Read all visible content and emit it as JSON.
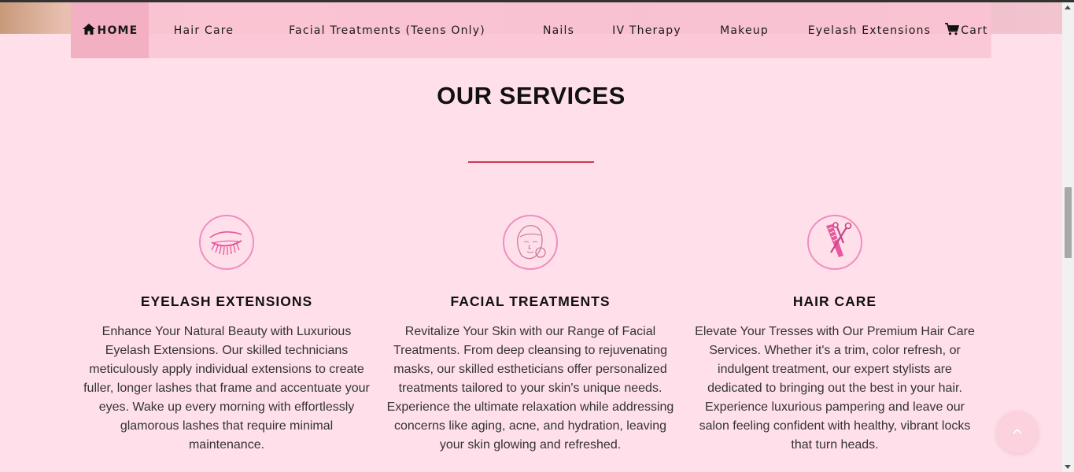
{
  "nav": {
    "items": [
      {
        "label": "HOME",
        "icon": "home-icon",
        "active": true
      },
      {
        "label": "Hair Care"
      },
      {
        "label": "Facial Treatments (Teens Only)"
      },
      {
        "label": "Nails"
      },
      {
        "label": "IV Therapy"
      },
      {
        "label": "Makeup"
      },
      {
        "label": "Eyelash Extensions"
      },
      {
        "label": "Cart",
        "icon": "cart-icon"
      }
    ]
  },
  "section": {
    "title": "OUR SERVICES"
  },
  "services": [
    {
      "icon": "eyelash-icon",
      "title": "EYELASH EXTENSIONS",
      "description": "Enhance Your Natural Beauty with Luxurious Eyelash Extensions. Our skilled technicians meticulously apply individual extensions to create fuller, longer lashes that frame and accentuate your eyes. Wake up every morning with effortlessly glamorous lashes that require minimal maintenance."
    },
    {
      "icon": "face-icon",
      "title": "FACIAL TREATMENTS",
      "description": "Revitalize Your Skin with our Range of Facial Treatments. From deep cleansing to rejuvenating masks, our skilled estheticians offer personalized treatments tailored to your skin's unique needs. Experience the ultimate relaxation while addressing concerns like aging, acne, and hydration, leaving your skin glowing and refreshed."
    },
    {
      "icon": "scissors-comb-icon",
      "title": "HAIR CARE",
      "description": "Elevate Your Tresses with Our Premium Hair Care Services. Whether it's a trim, color refresh, or indulgent treatment, our expert stylists are dedicated to bringing out the best in your hair. Experience luxurious pampering and leave our salon feeling confident with healthy, vibrant locks that turn heads."
    }
  ],
  "colors": {
    "background": "#ffe0ea",
    "nav_background": "#fac3d4",
    "nav_active": "#f4b0c3",
    "accent_pink": "#f28cc0",
    "divider_red": "#d0394f"
  }
}
